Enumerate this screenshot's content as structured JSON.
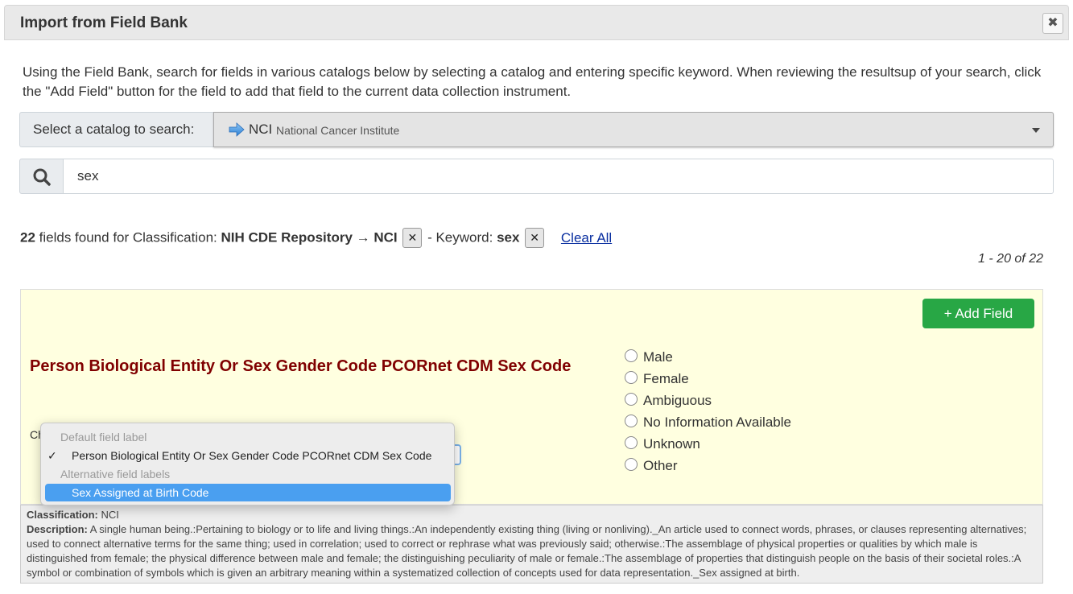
{
  "modal": {
    "title": "Import from Field Bank",
    "close_icon": "close-icon"
  },
  "intro_text": "Using the Field Bank, search for fields in various catalogs below by selecting a catalog and entering specific keyword. When reviewing the resultsup of your search, click the \"Add Field\" button for the field to add that field to the current data collection instrument.",
  "catalog": {
    "label": "Select a catalog to search:",
    "selected_abbr": "NCI",
    "selected_name": "National Cancer Institute",
    "icon": "arrow-right-icon"
  },
  "search": {
    "value": "sex",
    "icon": "search-icon"
  },
  "results": {
    "count": "22",
    "text_fields_found": " fields found for Classification: ",
    "classification": "NIH CDE Repository → NCI",
    "keyword_label": " - Keyword: ",
    "keyword": "sex",
    "remove_glyph": "✕",
    "clear_all": "Clear All",
    "pager": "1 - 20 of 22"
  },
  "field_card": {
    "add_button": "+ Add Field",
    "title": "Person Biological Entity Or Sex Gender Code PCORnet CDM Sex Code",
    "choose_label_partial": "Ch",
    "options": [
      {
        "label": "Male"
      },
      {
        "label": "Female"
      },
      {
        "label": "Ambiguous"
      },
      {
        "label": "No Information Available"
      },
      {
        "label": "Unknown"
      },
      {
        "label": "Other"
      }
    ],
    "classification_label": "Classification:",
    "classification_value": " NCI",
    "description_label": "Description:",
    "description_value": " A single human being.:Pertaining to biology or to life and living things.:An independently existing thing (living or nonliving)._An article used to connect words, phrases, or clauses representing alternatives; used to connect alternative terms for the same thing; used in correlation; used to correct or rephrase what was previously said; otherwise.:The assemblage of physical properties or qualities by which male is distinguished from female; the physical difference between male and female; the distinguishing peculiarity of male or female.:The assemblage of properties that distinguish people on the basis of their societal roles.:A symbol or combination of symbols which is given an arbitrary meaning within a systematized collection of concepts used for data representation._Sex assigned at birth."
  },
  "label_dropdown": {
    "header_default": "Default field label",
    "default_option": "Person Biological Entity Or Sex Gender Code PCORnet CDM Sex Code",
    "check_glyph": "✓",
    "header_alternative": "Alternative field labels",
    "highlighted_option": "Sex Assigned at Birth Code"
  },
  "colors": {
    "add_button": "#28a745",
    "field_title": "#800000",
    "card_background": "#ffffe0",
    "dropdown_highlight": "#4a9ff0"
  }
}
